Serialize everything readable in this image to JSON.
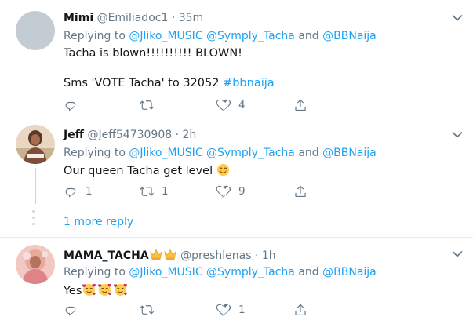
{
  "replies": [
    {
      "name": "Mimi",
      "handle": "@Emiliadoc1",
      "separator": "·",
      "time": "35m",
      "replying_prefix": "Replying to",
      "replying_users": [
        "@Jliko_MUSIC",
        "@Symply_Tacha"
      ],
      "replying_and": "and",
      "replying_last": "@BBNaija",
      "text_line1": "Tacha is blown!!!!!!!!!! BLOWN!",
      "text_line2_prefix": "Sms 'VOTE Tacha' to 32052",
      "text_line2_hashtag": "#bbnaija",
      "replies_count": "",
      "retweets_count": "",
      "likes_count": "4",
      "avatar": "grey-placeholder"
    },
    {
      "name": "Jeff",
      "handle": "@Jeff54730908",
      "separator": "·",
      "time": "2h",
      "replying_prefix": "Replying to",
      "replying_users": [
        "@Jliko_MUSIC",
        "@Symply_Tacha"
      ],
      "replying_and": "and",
      "replying_last": "@BBNaija",
      "text": "Our queen Tacha get level",
      "text_emoji": "smiling-face-emoji",
      "replies_count": "1",
      "retweets_count": "1",
      "likes_count": "9",
      "avatar": "photo"
    },
    {
      "name": "MAMA_TACHA",
      "name_emoji": "crown-emoji",
      "handle": "@preshlenas",
      "separator": "·",
      "time": "1h",
      "replying_prefix": "Replying to",
      "replying_users": [
        "@Jliko_MUSIC",
        "@Symply_Tacha"
      ],
      "replying_and": "and",
      "replying_last": "@BBNaija",
      "text": "Yes",
      "text_emoji": "smiling-face-with-hearts-emoji",
      "replies_count": "",
      "retweets_count": "",
      "likes_count": "1",
      "avatar": "photo"
    }
  ],
  "more_replies_label": "1 more reply",
  "colors": {
    "link": "#1da1f2",
    "muted": "#657786",
    "divider": "#e6ecf0",
    "text": "#14171a"
  }
}
